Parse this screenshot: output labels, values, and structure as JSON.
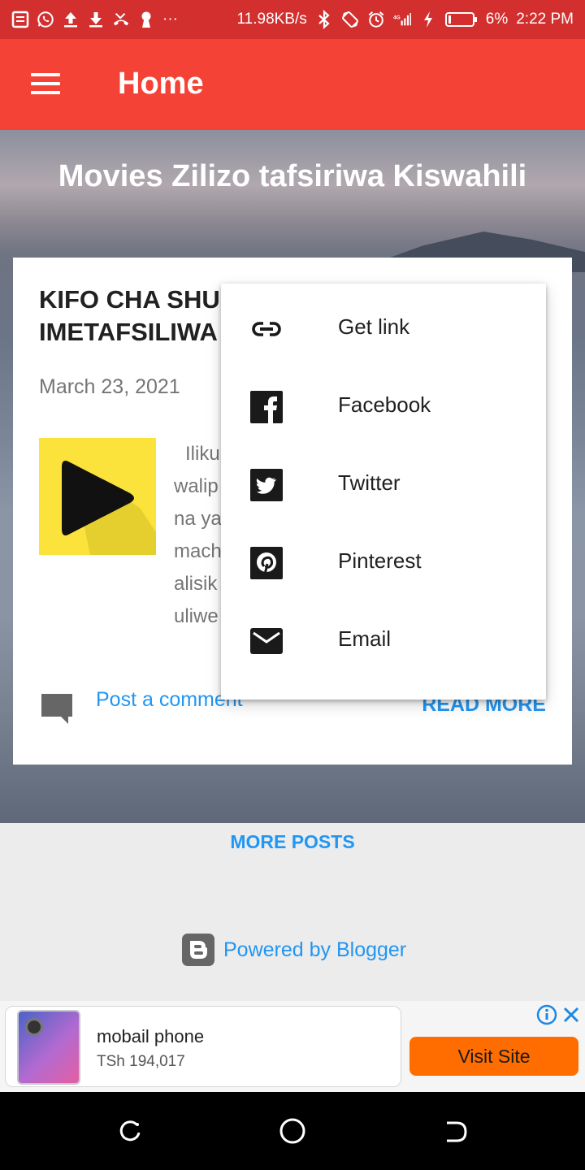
{
  "status_bar": {
    "network_speed": "11.98KB/s",
    "battery": "6%",
    "time": "2:22 PM",
    "more": "···"
  },
  "app_bar": {
    "title": "Home"
  },
  "blog": {
    "title": "Movies Zilizo tafsiriwa Kiswahili"
  },
  "post": {
    "title_line1": "KIFO CHA SHU",
    "title_line2": "IMETAFSILIWA",
    "date": "March 23, 2021",
    "snippet_lines": [
      "Iliku",
      "walip",
      "na ya",
      "mach",
      "alisik",
      "uliwe"
    ],
    "comment_link": "Post a comment",
    "read_more": "READ MORE"
  },
  "share_menu": {
    "items": [
      {
        "label": "Get link",
        "icon": "link-icon"
      },
      {
        "label": "Facebook",
        "icon": "facebook-icon"
      },
      {
        "label": "Twitter",
        "icon": "twitter-icon"
      },
      {
        "label": "Pinterest",
        "icon": "pinterest-icon"
      },
      {
        "label": "Email",
        "icon": "email-icon"
      }
    ]
  },
  "footer": {
    "more_posts": "MORE POSTS",
    "powered_by": "Powered by Blogger"
  },
  "ad": {
    "title": "mobail phone",
    "price": "TSh 194,017",
    "button": "Visit Site"
  },
  "colors": {
    "status_bar": "#d32f2f",
    "app_bar": "#f44336",
    "link": "#2196f3",
    "ad_button": "#ff6d00"
  }
}
